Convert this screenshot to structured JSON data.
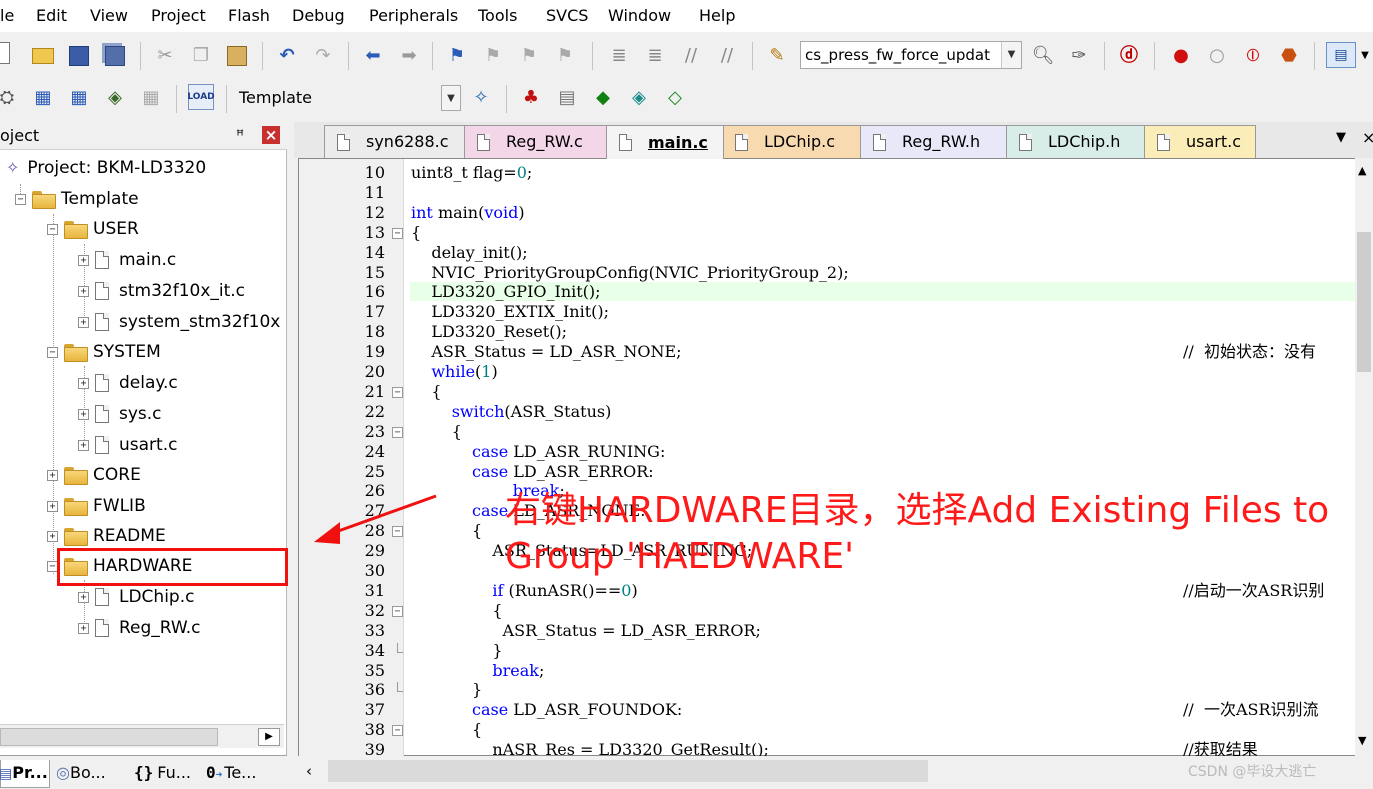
{
  "menu": [
    "le",
    "Edit",
    "View",
    "Project",
    "Flash",
    "Debug",
    "Peripherals",
    "Tools",
    "SVCS",
    "Window",
    "Help"
  ],
  "toolbar": {
    "target_combo": "cs_press_fw_force_updat",
    "target_name": "Template"
  },
  "project_panel": {
    "title": "oject",
    "pin": "ꟸ",
    "close": "×",
    "tree": {
      "project": "Project: BKM-LD3320",
      "target": "Template",
      "groups": [
        {
          "name": "USER",
          "files": [
            "main.c",
            "stm32f10x_it.c",
            "system_stm32f10x"
          ]
        },
        {
          "name": "SYSTEM",
          "files": [
            "delay.c",
            "sys.c",
            "usart.c"
          ]
        },
        {
          "name": "CORE",
          "files": []
        },
        {
          "name": "FWLIB",
          "files": []
        },
        {
          "name": "README",
          "files": []
        },
        {
          "name": "HARDWARE",
          "files": [
            "LDChip.c",
            "Reg_RW.c"
          ]
        }
      ]
    },
    "bottom_tabs": [
      "Pr...",
      "Bo...",
      "Fu...",
      "Te..."
    ]
  },
  "editor_tabs": [
    {
      "label": "syn6288.c",
      "color": "#ececec"
    },
    {
      "label": "Reg_RW.c",
      "color": "#f3d6e8"
    },
    {
      "label": "main.c",
      "color": "#f4f4f4"
    },
    {
      "label": "LDChip.c",
      "color": "#f8dab0"
    },
    {
      "label": "Reg_RW.h",
      "color": "#e8e8f8"
    },
    {
      "label": "LDChip.h",
      "color": "#d8ece8"
    },
    {
      "label": "usart.c",
      "color": "#fbedb8"
    }
  ],
  "code": {
    "line_numbers": [
      "10",
      "11",
      "12",
      "13",
      "14",
      "15",
      "16",
      "17",
      "18",
      "19",
      "20",
      "21",
      "22",
      "23",
      "24",
      "25",
      "26",
      "27",
      "28",
      "29",
      "30",
      "31",
      "32",
      "33",
      "34",
      "35",
      "36",
      "37",
      "38",
      "39"
    ],
    "lines": [
      "uint8_t flag=0;",
      "",
      "int main(void)",
      "{",
      "    delay_init();",
      "    NVIC_PriorityGroupConfig(NVIC_PriorityGroup_2);",
      "    LD3320_GPIO_Init();",
      "    LD3320_EXTIX_Init();",
      "    LD3320_Reset();",
      "    ASR_Status = LD_ASR_NONE;",
      "    while(1)",
      "    {",
      "        switch(ASR_Status)",
      "        {",
      "            case LD_ASR_RUNING:",
      "            case LD_ASR_ERROR:",
      "                    break;",
      "            case LD_ASR_NONE:",
      "            {",
      "                ASR_Status=LD_ASR_RUNING;",
      "",
      "                if (RunASR()==0)",
      "                {",
      "                  ASR_Status = LD_ASR_ERROR;",
      "                }",
      "                break;",
      "            }",
      "            case LD_ASR_FOUNDOK:",
      "            {",
      "                nASR_Res = LD3320_GetResult();"
    ],
    "comments": [
      {
        "line": "19",
        "text": "//  初始状态：没有"
      },
      {
        "line": "31",
        "text": "//启动一次ASR识别"
      },
      {
        "line": "37",
        "text": "//  一次ASR识别流"
      },
      {
        "line": "39",
        "text": "//获取结果"
      }
    ]
  },
  "annotation": "右键HARDWARE目录，选择Add Existing Files to Group 'HAEDWARE'",
  "watermark": "CSDN @毕设大逃亡"
}
